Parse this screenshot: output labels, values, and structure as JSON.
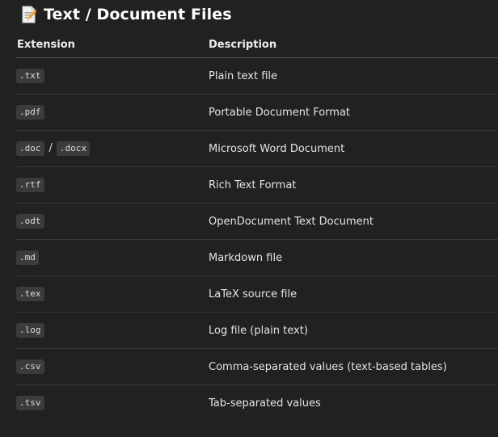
{
  "heading": {
    "icon": "memo-icon",
    "title": "Text / Document Files"
  },
  "table": {
    "columns": [
      "Extension",
      "Description"
    ],
    "rows": [
      {
        "extensions": [
          ".txt"
        ],
        "description": "Plain text file"
      },
      {
        "extensions": [
          ".pdf"
        ],
        "description": "Portable Document Format"
      },
      {
        "extensions": [
          ".doc",
          ".docx"
        ],
        "separator": "/",
        "description": "Microsoft Word Document"
      },
      {
        "extensions": [
          ".rtf"
        ],
        "description": "Rich Text Format"
      },
      {
        "extensions": [
          ".odt"
        ],
        "description": "OpenDocument Text Document"
      },
      {
        "extensions": [
          ".md"
        ],
        "description": "Markdown file"
      },
      {
        "extensions": [
          ".tex"
        ],
        "description": "LaTeX source file"
      },
      {
        "extensions": [
          ".log"
        ],
        "description": "Log file (plain text)"
      },
      {
        "extensions": [
          ".csv"
        ],
        "description": "Comma-separated values (text-based tables)"
      },
      {
        "extensions": [
          ".tsv"
        ],
        "description": "Tab-separated values"
      }
    ]
  }
}
